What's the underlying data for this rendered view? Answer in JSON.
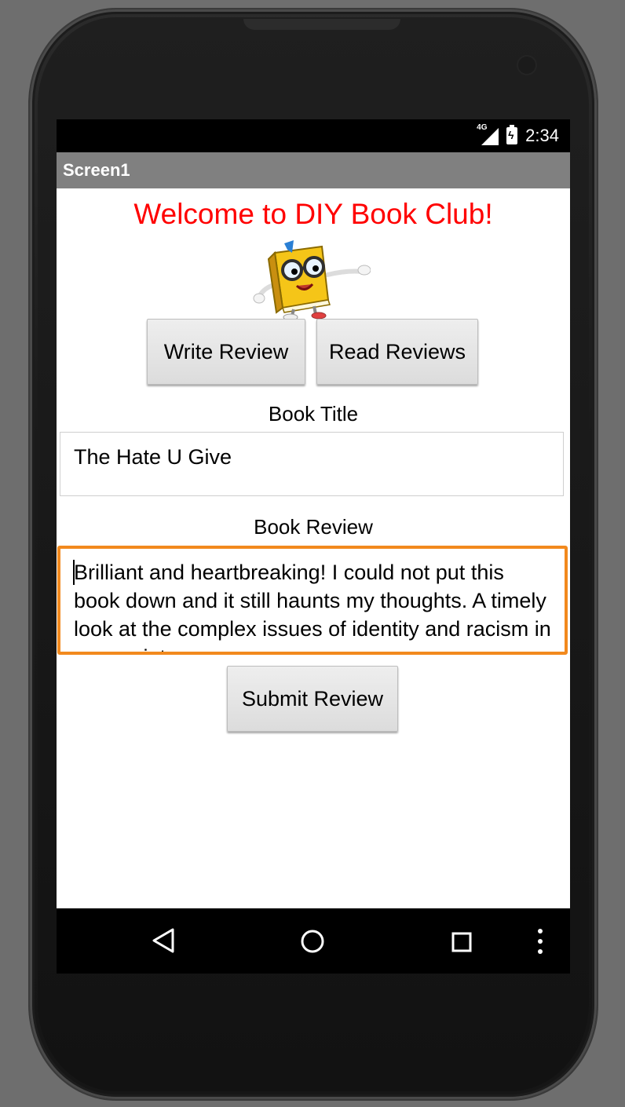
{
  "status_bar": {
    "network": "4G",
    "time": "2:34"
  },
  "app_bar": {
    "title": "Screen1"
  },
  "main": {
    "welcome": "Welcome  to DIY Book Club!",
    "write_review_label": "Write  Review",
    "read_reviews_label": "Read Reviews",
    "book_title_label": "Book Title",
    "book_title_value": "The  Hate U Give",
    "book_review_label": "Book  Review",
    "book_review_value": "Brilliant and heartbreaking!  I  could not put this book down  and  it still haunts my thoughts.   A timely look at the  complex  issues of  identity and racism in our society.",
    "submit_label": "Submit Review"
  },
  "colors": {
    "welcome": "#ff0000",
    "focus_border": "#f2891d",
    "app_bar": "#808080"
  },
  "icons": {
    "nav": [
      "back-icon",
      "home-icon",
      "recent-apps-icon",
      "overflow-menu-icon"
    ]
  }
}
